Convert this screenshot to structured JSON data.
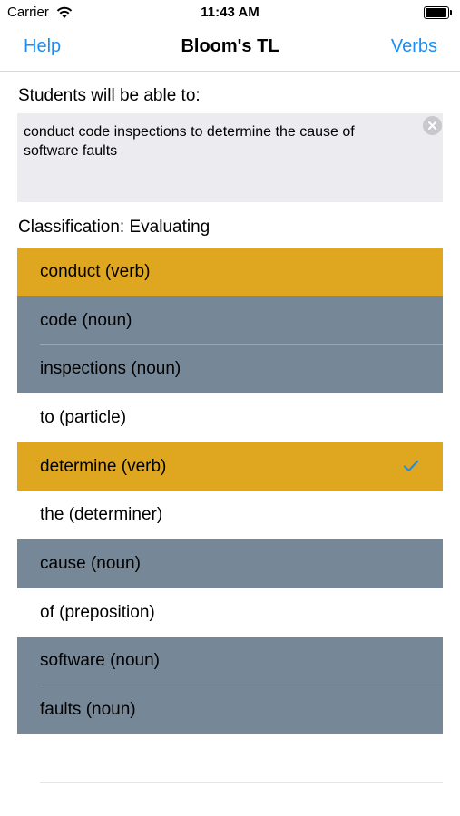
{
  "status": {
    "carrier": "Carrier",
    "time": "11:43 AM"
  },
  "nav": {
    "left": "Help",
    "title": "Bloom's TL",
    "right": "Verbs"
  },
  "prompt": "Students will be able to:",
  "objective_text": "conduct code inspections to determine the cause of software faults",
  "classification": {
    "label": "Classification: Evaluating"
  },
  "colors": {
    "verb": "#dfa71f",
    "noun": "#768797",
    "other": "#ffffff",
    "accent": "#1a8ef5"
  },
  "words": [
    {
      "label": "conduct (verb)",
      "kind": "verb",
      "checked": false
    },
    {
      "label": "code (noun)",
      "kind": "noun",
      "checked": false
    },
    {
      "label": "inspections (noun)",
      "kind": "noun",
      "checked": false
    },
    {
      "label": "to (particle)",
      "kind": "other",
      "checked": false
    },
    {
      "label": "determine (verb)",
      "kind": "verb",
      "checked": true
    },
    {
      "label": "the (determiner)",
      "kind": "other",
      "checked": false
    },
    {
      "label": "cause (noun)",
      "kind": "noun",
      "checked": false
    },
    {
      "label": "of (preposition)",
      "kind": "other",
      "checked": false
    },
    {
      "label": "software (noun)",
      "kind": "noun",
      "checked": false
    },
    {
      "label": "faults (noun)",
      "kind": "noun",
      "checked": false
    }
  ]
}
